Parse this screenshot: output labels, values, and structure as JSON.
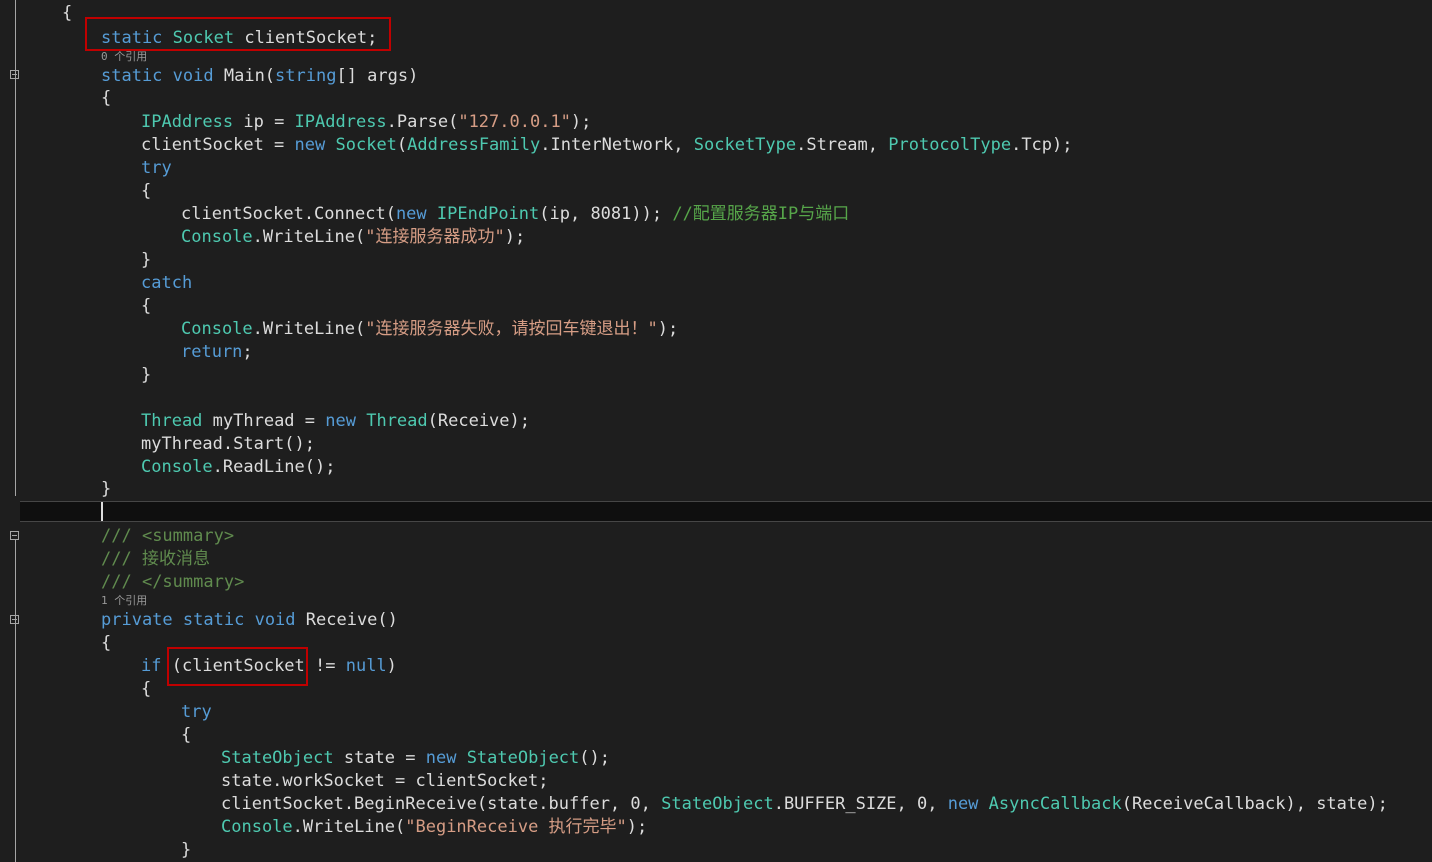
{
  "editor": {
    "codelens": [
      "0 个引用",
      "1 个引用"
    ],
    "lines": [
      {
        "key": "l01",
        "tokens": [
          {
            "t": "{",
            "c": "id"
          }
        ]
      },
      {
        "key": "l02",
        "tokens": [
          {
            "t": "static",
            "c": "kw"
          },
          {
            "t": " ",
            "c": "id"
          },
          {
            "t": "Socket",
            "c": "ty"
          },
          {
            "t": " clientSocket;",
            "c": "id"
          }
        ]
      },
      {
        "key": "l03",
        "tokens": [
          {
            "t": "static",
            "c": "kw"
          },
          {
            "t": " ",
            "c": "id"
          },
          {
            "t": "void",
            "c": "kw"
          },
          {
            "t": " Main(",
            "c": "id"
          },
          {
            "t": "string",
            "c": "kw"
          },
          {
            "t": "[] args)",
            "c": "id"
          }
        ]
      },
      {
        "key": "l04",
        "tokens": [
          {
            "t": "{",
            "c": "id"
          }
        ]
      },
      {
        "key": "l05",
        "tokens": [
          {
            "t": "IPAddress",
            "c": "ty"
          },
          {
            "t": " ip = ",
            "c": "id"
          },
          {
            "t": "IPAddress",
            "c": "ty"
          },
          {
            "t": ".Parse(",
            "c": "id"
          },
          {
            "t": "\"127.0.0.1\"",
            "c": "str"
          },
          {
            "t": ");",
            "c": "id"
          }
        ]
      },
      {
        "key": "l06",
        "tokens": [
          {
            "t": "clientSocket = ",
            "c": "id"
          },
          {
            "t": "new",
            "c": "kw"
          },
          {
            "t": " ",
            "c": "id"
          },
          {
            "t": "Socket",
            "c": "ty"
          },
          {
            "t": "(",
            "c": "id"
          },
          {
            "t": "AddressFamily",
            "c": "ty"
          },
          {
            "t": ".InterNetwork, ",
            "c": "id"
          },
          {
            "t": "SocketType",
            "c": "ty"
          },
          {
            "t": ".Stream, ",
            "c": "id"
          },
          {
            "t": "ProtocolType",
            "c": "ty"
          },
          {
            "t": ".Tcp);",
            "c": "id"
          }
        ]
      },
      {
        "key": "l07",
        "tokens": [
          {
            "t": "try",
            "c": "kw"
          }
        ]
      },
      {
        "key": "l08",
        "tokens": [
          {
            "t": "{",
            "c": "id"
          }
        ]
      },
      {
        "key": "l09",
        "tokens": [
          {
            "t": "clientSocket.Connect(",
            "c": "id"
          },
          {
            "t": "new",
            "c": "kw"
          },
          {
            "t": " ",
            "c": "id"
          },
          {
            "t": "IPEndPoint",
            "c": "ty"
          },
          {
            "t": "(ip, 8081)); ",
            "c": "id"
          },
          {
            "t": "//配置服务器IP与端口",
            "c": "cm"
          }
        ]
      },
      {
        "key": "l10",
        "tokens": [
          {
            "t": "Console",
            "c": "ty"
          },
          {
            "t": ".WriteLine(",
            "c": "id"
          },
          {
            "t": "\"连接服务器成功\"",
            "c": "str"
          },
          {
            "t": ");",
            "c": "id"
          }
        ]
      },
      {
        "key": "l11",
        "tokens": [
          {
            "t": "}",
            "c": "id"
          }
        ]
      },
      {
        "key": "l12",
        "tokens": [
          {
            "t": "catch",
            "c": "kw"
          }
        ]
      },
      {
        "key": "l13",
        "tokens": [
          {
            "t": "{",
            "c": "id"
          }
        ]
      },
      {
        "key": "l14",
        "tokens": [
          {
            "t": "Console",
            "c": "ty"
          },
          {
            "t": ".WriteLine(",
            "c": "id"
          },
          {
            "t": "\"连接服务器失败，请按回车键退出！\"",
            "c": "str"
          },
          {
            "t": ");",
            "c": "id"
          }
        ]
      },
      {
        "key": "l15",
        "tokens": [
          {
            "t": "return",
            "c": "kw"
          },
          {
            "t": ";",
            "c": "id"
          }
        ]
      },
      {
        "key": "l16",
        "tokens": [
          {
            "t": "}",
            "c": "id"
          }
        ]
      },
      {
        "key": "l17",
        "tokens": []
      },
      {
        "key": "l18",
        "tokens": [
          {
            "t": "Thread",
            "c": "ty"
          },
          {
            "t": " myThread = ",
            "c": "id"
          },
          {
            "t": "new",
            "c": "kw"
          },
          {
            "t": " ",
            "c": "id"
          },
          {
            "t": "Thread",
            "c": "ty"
          },
          {
            "t": "(Receive);",
            "c": "id"
          }
        ]
      },
      {
        "key": "l19",
        "tokens": [
          {
            "t": "myThread.Start();",
            "c": "id"
          }
        ]
      },
      {
        "key": "l20",
        "tokens": [
          {
            "t": "Console",
            "c": "ty"
          },
          {
            "t": ".ReadLine();",
            "c": "id"
          }
        ]
      },
      {
        "key": "l21",
        "tokens": [
          {
            "t": "}",
            "c": "id"
          }
        ]
      },
      {
        "key": "l22",
        "tokens": []
      },
      {
        "key": "l23",
        "tokens": [
          {
            "t": "/// ",
            "c": "xml"
          },
          {
            "t": "<summary>",
            "c": "xml"
          }
        ]
      },
      {
        "key": "l24",
        "tokens": [
          {
            "t": "/// 接收消息",
            "c": "xml"
          }
        ]
      },
      {
        "key": "l25",
        "tokens": [
          {
            "t": "/// ",
            "c": "xml"
          },
          {
            "t": "</summary>",
            "c": "xml"
          }
        ]
      },
      {
        "key": "l26",
        "tokens": [
          {
            "t": "private",
            "c": "kw"
          },
          {
            "t": " ",
            "c": "id"
          },
          {
            "t": "static",
            "c": "kw"
          },
          {
            "t": " ",
            "c": "id"
          },
          {
            "t": "void",
            "c": "kw"
          },
          {
            "t": " Receive()",
            "c": "id"
          }
        ]
      },
      {
        "key": "l27",
        "tokens": [
          {
            "t": "{",
            "c": "id"
          }
        ]
      },
      {
        "key": "l28",
        "tokens": [
          {
            "t": "if",
            "c": "kw"
          },
          {
            "t": " (clientSocket != ",
            "c": "id"
          },
          {
            "t": "null",
            "c": "kw"
          },
          {
            "t": ")",
            "c": "id"
          }
        ]
      },
      {
        "key": "l29",
        "tokens": [
          {
            "t": "{",
            "c": "id"
          }
        ]
      },
      {
        "key": "l30",
        "tokens": [
          {
            "t": "try",
            "c": "kw"
          }
        ]
      },
      {
        "key": "l31",
        "tokens": [
          {
            "t": "{",
            "c": "id"
          }
        ]
      },
      {
        "key": "l32",
        "tokens": [
          {
            "t": "StateObject",
            "c": "ty"
          },
          {
            "t": " state = ",
            "c": "id"
          },
          {
            "t": "new",
            "c": "kw"
          },
          {
            "t": " ",
            "c": "id"
          },
          {
            "t": "StateObject",
            "c": "ty"
          },
          {
            "t": "();",
            "c": "id"
          }
        ]
      },
      {
        "key": "l33",
        "tokens": [
          {
            "t": "state.workSocket = clientSocket;",
            "c": "id"
          }
        ]
      },
      {
        "key": "l34",
        "tokens": [
          {
            "t": "clientSocket.BeginReceive(state.buffer, 0, ",
            "c": "id"
          },
          {
            "t": "StateObject",
            "c": "ty"
          },
          {
            "t": ".BUFFER_SIZE, 0, ",
            "c": "id"
          },
          {
            "t": "new",
            "c": "kw"
          },
          {
            "t": " ",
            "c": "id"
          },
          {
            "t": "AsyncCallback",
            "c": "ty"
          },
          {
            "t": "(ReceiveCallback), state);",
            "c": "id"
          }
        ]
      },
      {
        "key": "l35",
        "tokens": [
          {
            "t": "Console",
            "c": "ty"
          },
          {
            "t": ".WriteLine(",
            "c": "id"
          },
          {
            "t": "\"BeginReceive 执行完毕\"",
            "c": "str"
          },
          {
            "t": ");",
            "c": "id"
          }
        ]
      },
      {
        "key": "l36",
        "tokens": [
          {
            "t": "}",
            "c": "id"
          }
        ]
      }
    ]
  }
}
